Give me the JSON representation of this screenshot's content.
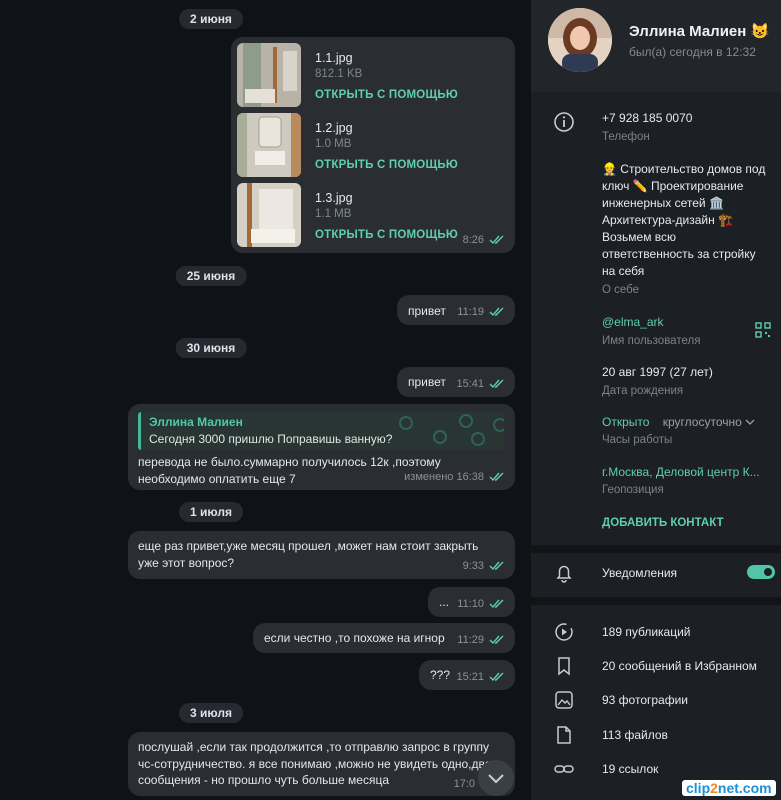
{
  "chat": {
    "dates": [
      "2 июня",
      "25 июня",
      "30 июня",
      "1 июля",
      "3 июля"
    ],
    "files": [
      {
        "name": "1.1.jpg",
        "size": "812.1 KB",
        "action": "ОТКРЫТЬ С ПОМОЩЬЮ"
      },
      {
        "name": "1.2.jpg",
        "size": "1.0 MB",
        "action": "ОТКРЫТЬ С ПОМОЩЬЮ"
      },
      {
        "name": "1.3.jpg",
        "size": "1.1 MB",
        "action": "ОТКРЫТЬ С ПОМОЩЬЮ"
      }
    ],
    "files_time": "8:26",
    "messages": [
      {
        "text": "привет",
        "time": "11:19"
      },
      {
        "text": "привет",
        "time": "15:41"
      },
      {
        "reply_name": "Эллина Малиен",
        "reply_text": "Сегодня 3000 пришлю Поправишь ванную?",
        "text_lines": [
          "перевода не было.суммарно получилось 12к ,поэтому",
          "необходимо оплатить еще 7"
        ],
        "time": "изменено 16:38"
      },
      {
        "text_lines": [
          "еще раз привет,уже месяц прошел ,может нам стоит закрыть",
          "уже этот вопрос?"
        ],
        "time": "9:33"
      },
      {
        "text": "...",
        "time": "11:10"
      },
      {
        "text": "если честно ,то похоже на игнор",
        "time": "11:29"
      },
      {
        "text": "???",
        "time": "15:21"
      },
      {
        "text_lines": [
          "послушай ,если так продолжится ,то отправлю запрос в группу",
          "чс-сотрудничество. я все понимаю ,можно не увидеть одно,два",
          "сообщения - но прошло чуть больше месяца"
        ],
        "time": "17:0"
      }
    ]
  },
  "profile": {
    "name": "Эллина Малиен",
    "name_emoji": "😺",
    "status": "был(а) сегодня в 12:32",
    "phone": "+7 928 185 0070",
    "phone_label": "Телефон",
    "about_lines": [
      "👷 Строительство домов под",
      "ключ ✏️ Проектирование",
      "инженерных сетей 🏛️",
      "Архитектура-дизайн 🏗️",
      "Возьмем всю",
      "ответственность за стройку",
      "на себя"
    ],
    "about_label": "О себе",
    "username": "@elma_ark",
    "username_label": "Имя пользователя",
    "birthday": "20 авг 1997 (27 лет)",
    "birthday_label": "Дата рождения",
    "hours_status": "Открыто",
    "hours_value": "круглосуточно",
    "hours_label": "Часы работы",
    "location": "г.Москва, Деловой центр К...",
    "location_label": "Геопозиция",
    "add_contact": "ДОБАВИТЬ КОНТАКТ",
    "notifications": "Уведомления",
    "notifications_on": true,
    "media": [
      "189 публикаций",
      "20 сообщений в Избранном",
      "93 фотографии",
      "113 файлов",
      "19 ссылок"
    ]
  },
  "watermark": {
    "part1": "clip",
    "part2": "2",
    "part3": "net.com"
  },
  "colors": {
    "accent": "#5fcfb0",
    "bubble": "#2a2d32",
    "panel": "#1c1f24"
  }
}
